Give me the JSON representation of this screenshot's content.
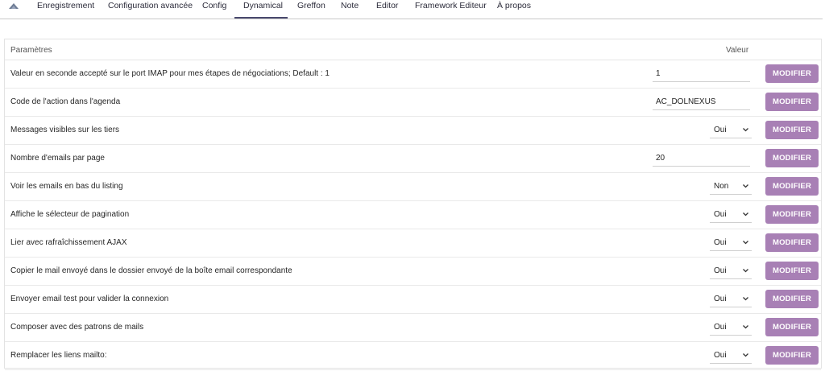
{
  "tabs": [
    {
      "label": "Enregistrement",
      "active": false
    },
    {
      "label": "Configuration avancée",
      "active": false
    },
    {
      "label": "Config",
      "active": false
    },
    {
      "label": "Dynamical",
      "active": true
    },
    {
      "label": "Greffon",
      "active": false
    },
    {
      "label": "Note",
      "active": false
    },
    {
      "label": "Editor",
      "active": false
    },
    {
      "label": "Framework Editeur",
      "active": false
    },
    {
      "label": "À propos",
      "active": false
    }
  ],
  "table": {
    "col_params": "Paramètres",
    "col_value": "Valeur",
    "button_label": "MODIFIER",
    "rows": [
      {
        "label": "Valeur en seconde accepté sur le port IMAP pour mes étapes de négociations; Default : 1",
        "kind": "text",
        "value": "1"
      },
      {
        "label": "Code de l'action dans l'agenda",
        "kind": "text",
        "value": "AC_DOLNEXUS"
      },
      {
        "label": "Messages visibles sur les tiers",
        "kind": "select",
        "value": "Oui"
      },
      {
        "label": "Nombre d'emails par page",
        "kind": "text",
        "value": "20"
      },
      {
        "label": "Voir les emails en bas du listing",
        "kind": "select",
        "value": "Non"
      },
      {
        "label": "Affiche le sélecteur de pagination",
        "kind": "select",
        "value": "Oui"
      },
      {
        "label": "Lier avec rafraîchissement AJAX",
        "kind": "select",
        "value": "Oui"
      },
      {
        "label": "Copier le mail envoyé dans le dossier envoyé de la boîte email correspondante",
        "kind": "select",
        "value": "Oui"
      },
      {
        "label": "Envoyer email test pour valider la connexion",
        "kind": "select",
        "value": "Oui"
      },
      {
        "label": "Composer avec des patrons de mails",
        "kind": "select",
        "value": "Oui"
      },
      {
        "label": "Remplacer les liens mailto:",
        "kind": "select",
        "value": "Oui"
      }
    ]
  },
  "colors": {
    "button_bg": "#a880b5",
    "active_tab_underline": "#4a4a6e"
  },
  "icons": {
    "tab_logo": "app-logo-icon",
    "select_arrow": "chevron-down-icon"
  }
}
